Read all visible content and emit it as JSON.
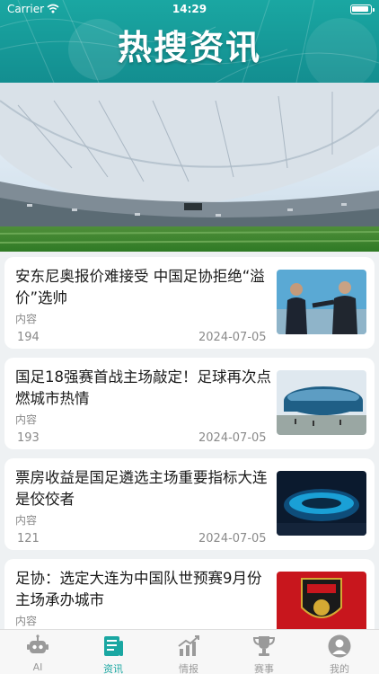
{
  "status": {
    "carrier": "Carrier",
    "time": "14:29"
  },
  "header": {
    "title": "热搜资讯"
  },
  "news": [
    {
      "title": "安东尼奥报价难接受  中国足协拒绝“溢价”选帅",
      "content": "内容",
      "views": "194",
      "date": "2024-07-05",
      "thumb": "coaches"
    },
    {
      "title": "国足18强赛首战主场敲定！足球再次点燃城市热情",
      "content": "内容",
      "views": "193",
      "date": "2024-07-05",
      "thumb": "stadium-day"
    },
    {
      "title": "票房收益是国足遴选主场重要指标大连是佼佼者",
      "content": "内容",
      "views": "121",
      "date": "2024-07-05",
      "thumb": "stadium-night"
    },
    {
      "title": "足协：选定大连为中国队世预赛9月份主场承办城市",
      "content": "内容",
      "views": "",
      "date": "",
      "thumb": "cfa-jersey"
    }
  ],
  "tabs": [
    {
      "label": "AI",
      "icon": "robot-icon",
      "active": false
    },
    {
      "label": "资讯",
      "icon": "news-icon",
      "active": true
    },
    {
      "label": "情报",
      "icon": "chart-icon",
      "active": false
    },
    {
      "label": "赛事",
      "icon": "trophy-icon",
      "active": false
    },
    {
      "label": "我的",
      "icon": "user-icon",
      "active": false
    }
  ],
  "colors": {
    "accent": "#1aa7a2",
    "header": "#138e90",
    "inactive": "#9a9a9a"
  }
}
